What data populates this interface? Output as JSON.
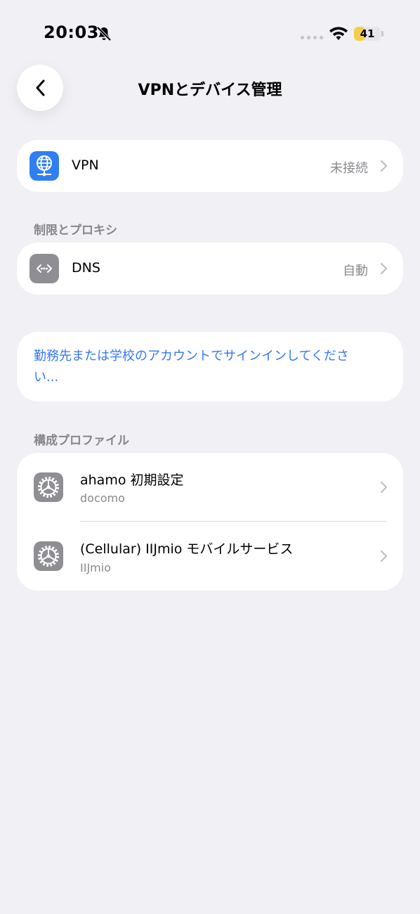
{
  "status_bar": {
    "time": "20:03",
    "battery_level": "41",
    "battery_fraction": 0.41
  },
  "header": {
    "title": "VPNとデバイス管理"
  },
  "vpn_row": {
    "label": "VPN",
    "value": "未接続"
  },
  "proxy_section": {
    "header": "制限とプロキシ"
  },
  "dns_row": {
    "label": "DNS",
    "value": "自動"
  },
  "work_account": {
    "link": "勤務先または学校のアカウントでサインインしてください..."
  },
  "profiles_section": {
    "header": "構成プロファイル",
    "items": [
      {
        "name": "ahamo 初期設定",
        "issuer": "docomo"
      },
      {
        "name": "(Cellular) IIJmio モバイルサービス",
        "issuer": "IIJmio"
      }
    ]
  },
  "colors": {
    "accent": "#3478f6",
    "background": "#f0f0f5",
    "battery": "#f3cf49"
  }
}
